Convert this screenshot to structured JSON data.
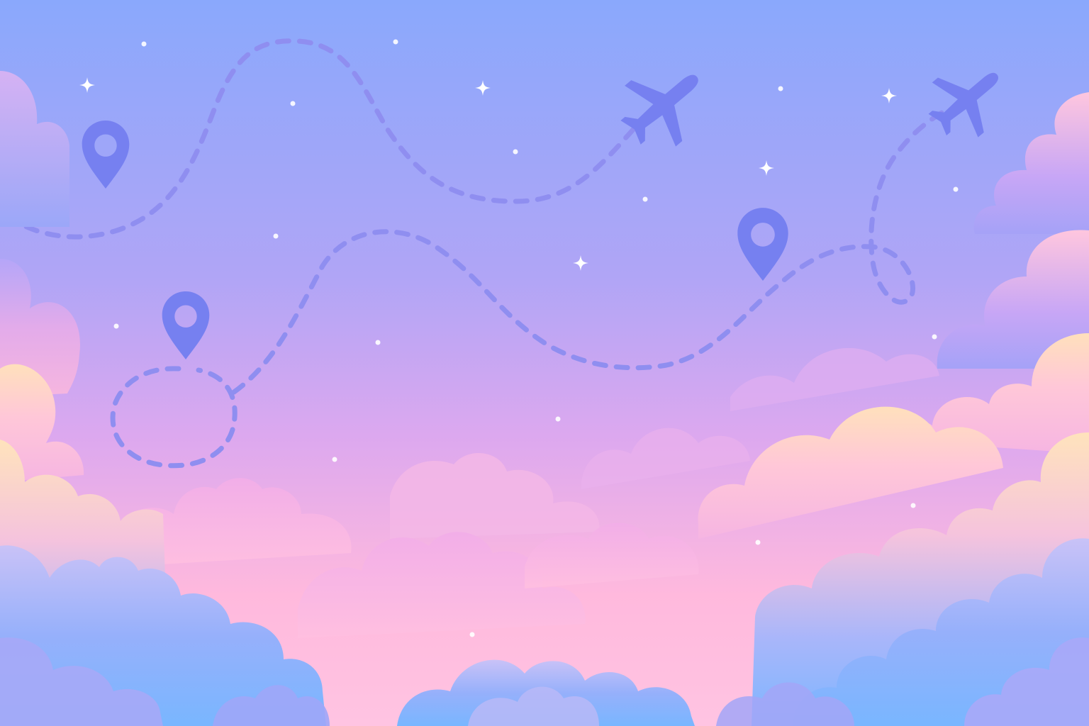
{
  "scene": {
    "description_free": true,
    "colors": {
      "sky_top": "#8AA8FC",
      "sky_mid": "#B7A3F4",
      "sky_lower": "#E7A6EC",
      "sky_bottom": "#FFB9DD",
      "route": "#8F8EF0",
      "icon": "#7680F0",
      "star": "#FFFFFF",
      "cloud_peach": "#FFE2B8",
      "cloud_pink": "#FFBCDF",
      "cloud_lilac": "#C7A8F5",
      "cloud_blue": "#78B7FF"
    },
    "icons": {
      "airplane": "airplane-icon",
      "location_pin": "location-pin-icon",
      "sparkle": "sparkle-icon"
    }
  }
}
